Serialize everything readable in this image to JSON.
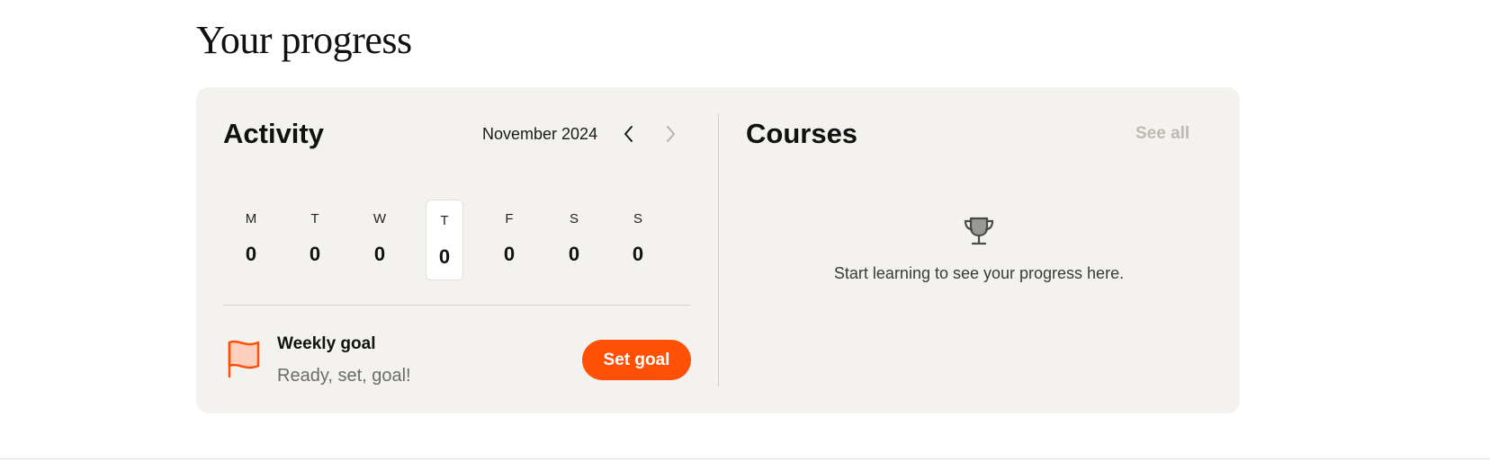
{
  "page": {
    "heading": "Your progress"
  },
  "activity": {
    "title": "Activity",
    "month": "November 2024",
    "prev_icon": "chevron-left-icon",
    "next_icon": "chevron-right-icon",
    "days": [
      {
        "letter": "M",
        "count": "0",
        "today": false
      },
      {
        "letter": "T",
        "count": "0",
        "today": false
      },
      {
        "letter": "W",
        "count": "0",
        "today": false
      },
      {
        "letter": "T",
        "count": "0",
        "today": true
      },
      {
        "letter": "F",
        "count": "0",
        "today": false
      },
      {
        "letter": "S",
        "count": "0",
        "today": false
      },
      {
        "letter": "S",
        "count": "0",
        "today": false
      }
    ],
    "weekly_goal": {
      "icon": "flag-icon",
      "title": "Weekly goal",
      "subtitle": "Ready, set, goal!",
      "button_label": "Set goal"
    }
  },
  "courses": {
    "title": "Courses",
    "see_all_label": "See all",
    "empty_icon": "trophy-icon",
    "empty_text": "Start learning to see your progress here."
  },
  "colors": {
    "accent": "#ff5005",
    "card_background": "#f4f2ee",
    "flag_fill": "#fdd0bd",
    "muted_link": "#bdbab4"
  }
}
